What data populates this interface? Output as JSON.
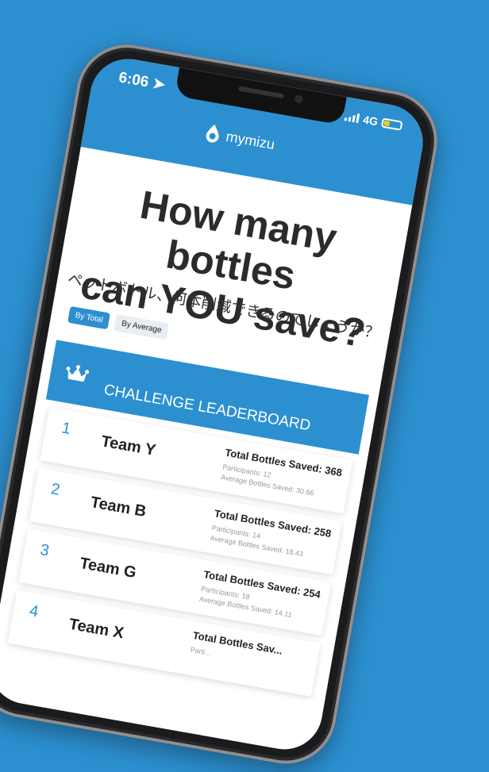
{
  "status": {
    "time": "6:06",
    "network": "4G"
  },
  "brand": {
    "name": "mymizu",
    "color": "#2c90d0"
  },
  "headline": {
    "line1": "How many bottles",
    "line2": "can YOU save?"
  },
  "subtitle": "ペットボトル、何本削減できるのでしょうか？",
  "filters": {
    "total_label": "By Total",
    "average_label": "By Average"
  },
  "leaderboard": {
    "title": "CHALLENGE LEADERBOARD",
    "rows": [
      {
        "rank": "1",
        "team": "Team Y",
        "total": "Total Bottles Saved: 368",
        "participants": "Participants: 12",
        "average": "Average Bottles Saved: 30.66"
      },
      {
        "rank": "2",
        "team": "Team B",
        "total": "Total Bottles Saved: 258",
        "participants": "Participants: 14",
        "average": "Average Bottles Saved: 18.43"
      },
      {
        "rank": "3",
        "team": "Team G",
        "total": "Total Bottles Saved: 254",
        "participants": "Participants: 18",
        "average": "Average Bottles Saved: 14.11"
      },
      {
        "rank": "4",
        "team": "Team X",
        "total": "Total Bottles Sav...",
        "participants": "Parti...",
        "average": ""
      }
    ]
  },
  "icons": [
    "location-arrow-icon",
    "signal-bars-icon",
    "battery-icon",
    "water-drop-logo-icon",
    "crown-icon"
  ]
}
